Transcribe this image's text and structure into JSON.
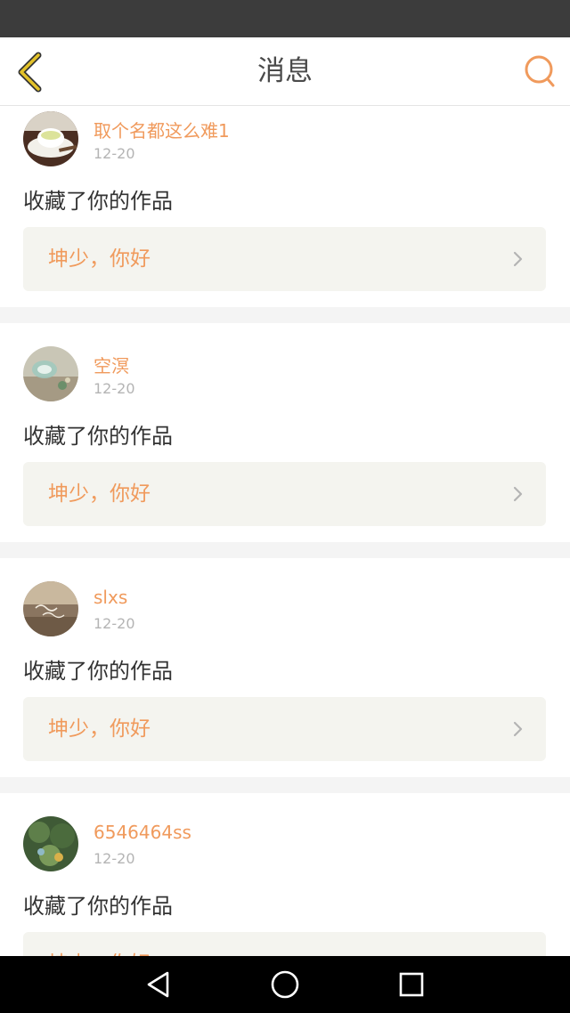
{
  "header": {
    "title": "消息",
    "colors": {
      "accent": "#f09a5c",
      "back_arrow": "#e3c229",
      "search_icon": "#f09a5c"
    }
  },
  "messages": [
    {
      "username": "取个名都这么难1",
      "date": "12-20",
      "action": "收藏了你的作品",
      "work_title": "坤少，你好",
      "avatar": "teacup-photo-avatar"
    },
    {
      "username": "空溟",
      "date": "12-20",
      "action": "收藏了你的作品",
      "work_title": "坤少，你好",
      "avatar": "glass-jar-photo-avatar"
    },
    {
      "username": "slxs",
      "date": "12-20",
      "action": "收藏了你的作品",
      "work_title": "坤少，你好",
      "avatar": "hello-august-photo-avatar"
    },
    {
      "username": "6546464ss",
      "date": "12-20",
      "action": "收藏了你的作品",
      "work_title": "坤少，你好",
      "avatar": "garden-photo-avatar"
    }
  ],
  "system_nav": {
    "icons": [
      "back-triangle-icon",
      "home-circle-icon",
      "recents-square-icon"
    ]
  }
}
